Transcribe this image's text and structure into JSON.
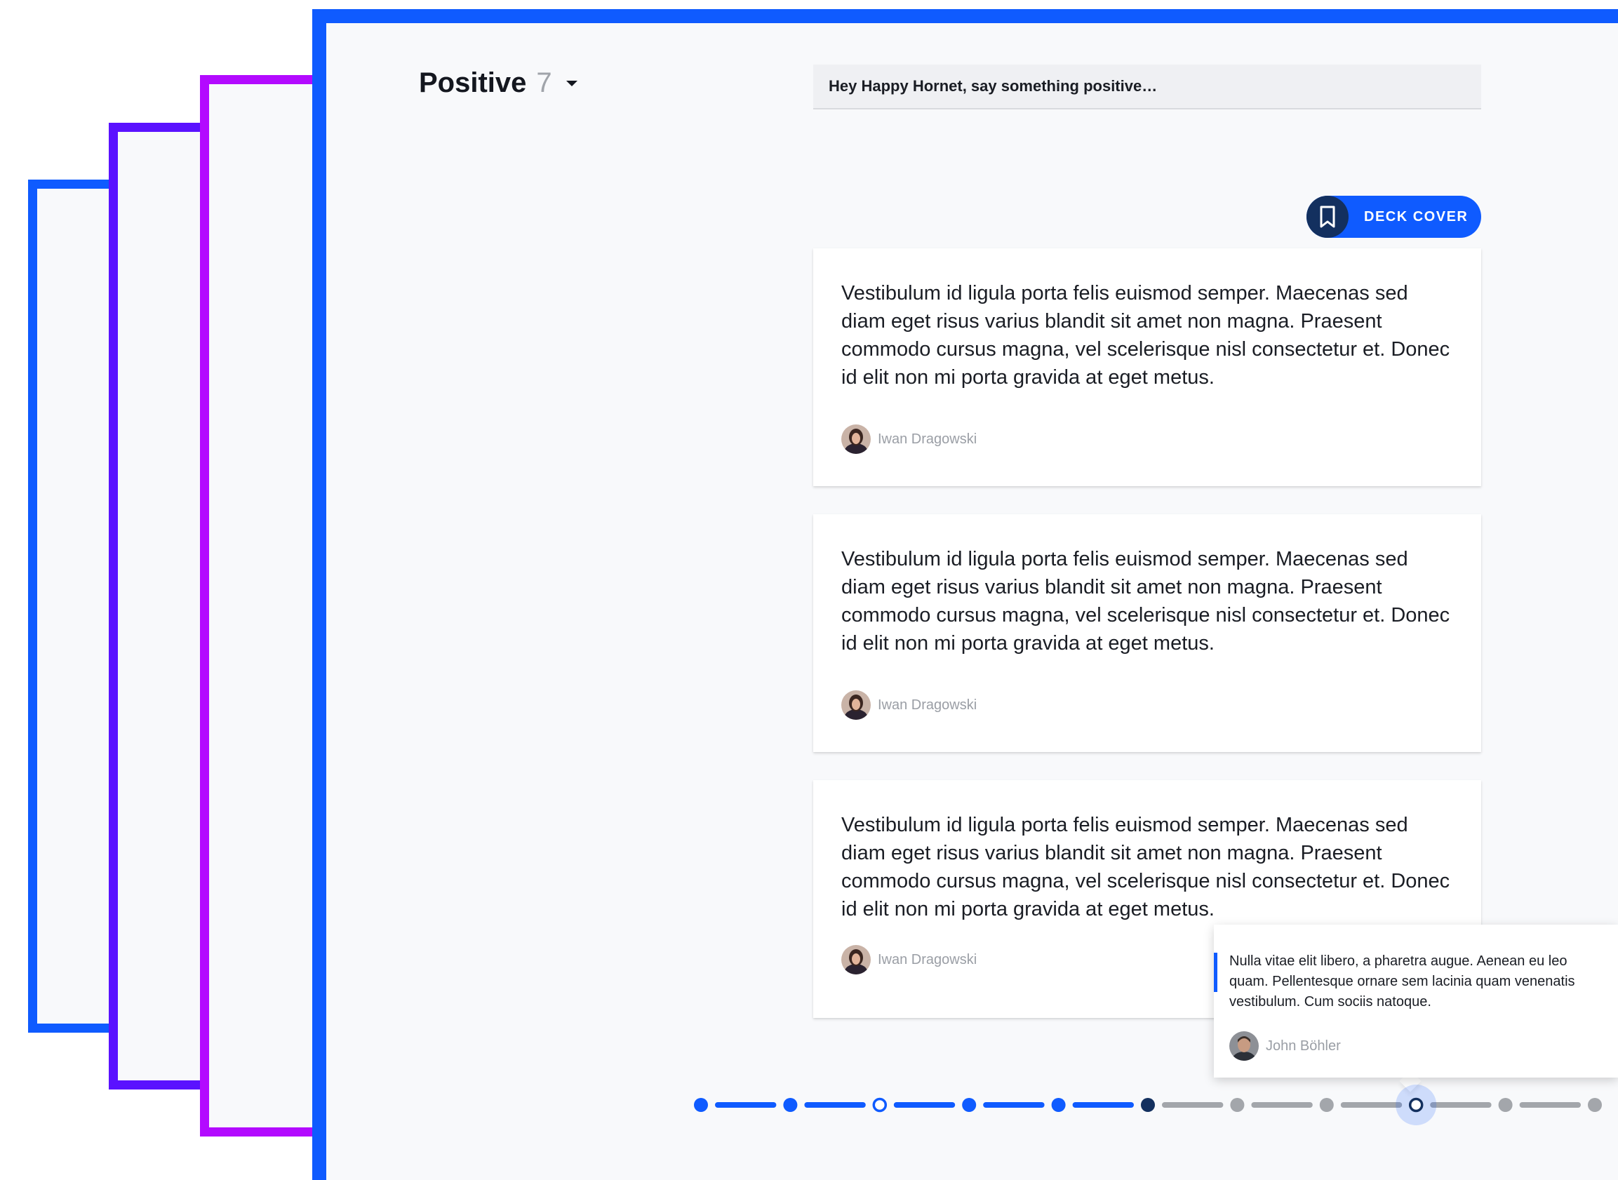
{
  "column": {
    "title": "Positive",
    "count": "7"
  },
  "composer": {
    "placeholder": "Hey Happy Hornet, say something positive…"
  },
  "deck_cover": {
    "label": "DECK COVER",
    "icon": "bookmark-icon"
  },
  "cards": [
    {
      "text": "Vestibulum id ligula porta felis euismod semper. Maecenas sed diam eget risus varius blandit sit amet non magna. Praesent commodo cursus magna, vel scelerisque nisl consectetur et. Donec id elit non mi porta gravida at eget metus.",
      "author": "Iwan Dragowski"
    },
    {
      "text": "Vestibulum id ligula porta felis euismod semper. Maecenas sed diam eget risus varius blandit sit amet non magna. Praesent commodo cursus magna, vel scelerisque nisl consectetur et. Donec id elit non mi porta gravida at eget metus.",
      "author": "Iwan Dragowski"
    },
    {
      "text": "Vestibulum id ligula porta felis euismod semper. Maecenas sed diam eget risus varius blandit sit amet non magna. Praesent commodo cursus magna, vel scelerisque nisl consectetur et. Donec id elit non mi porta gravida at eget metus.",
      "author": "Iwan Dragowski"
    }
  ],
  "tooltip": {
    "text": "Nulla vitae elit libero, a pharetra augue. Aenean eu leo quam. Pellentesque ornare sem lacinia quam venenatis vestibulum. Cum sociis natoque.",
    "author": "John Böhler"
  },
  "timeline": {
    "steps": [
      {
        "state": "done"
      },
      {
        "state": "done"
      },
      {
        "state": "open"
      },
      {
        "state": "done"
      },
      {
        "state": "done"
      },
      {
        "state": "current"
      },
      {
        "state": "todo"
      },
      {
        "state": "todo"
      },
      {
        "state": "highlighted"
      },
      {
        "state": "todo"
      },
      {
        "state": "todo"
      }
    ]
  },
  "colors": {
    "primary": "#0f5bff",
    "dark_navy": "#13305f",
    "frame_violet": "#5a12ff",
    "frame_purple": "#b30aff",
    "inactive": "#a3a6ab",
    "board_bg": "#f8f9fb"
  }
}
